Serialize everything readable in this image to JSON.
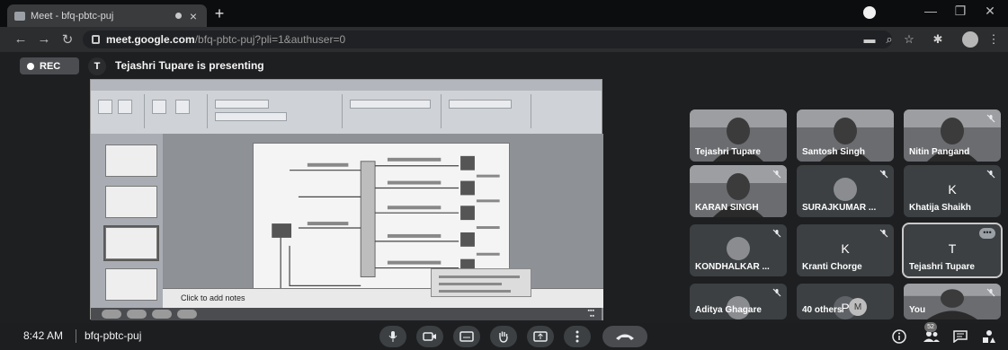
{
  "browser": {
    "tab_title": "Meet - bfq-pbtc-puj",
    "tab_close": "×",
    "new_tab": "+",
    "url_host": "meet.google.com",
    "url_path": "/bfq-pbtc-puj?pli=1&authuser=0",
    "window_controls": [
      "—",
      "❐",
      "✕"
    ]
  },
  "meet": {
    "rec_label": "REC",
    "presenter_initial": "T",
    "presenting_text": "Tejashri Tupare is presenting",
    "shared_screen": {
      "notes_placeholder": "Click to add notes"
    },
    "participants": [
      {
        "name": "Tejashri Tupare",
        "type": "video",
        "muted": false
      },
      {
        "name": "Santosh Singh",
        "type": "video",
        "muted": false
      },
      {
        "name": "Nitin Pangand",
        "type": "video",
        "muted": true
      },
      {
        "name": "KARAN SINGH",
        "type": "video",
        "muted": true
      },
      {
        "name": "SURAJKUMAR ...",
        "type": "avatar",
        "muted": true
      },
      {
        "name": "Khatija Shaikh",
        "type": "letter",
        "initial": "K",
        "muted": true
      },
      {
        "name": "KONDHALKAR ...",
        "type": "avatar",
        "muted": true
      },
      {
        "name": "Kranti Chorge",
        "type": "letter",
        "initial": "K",
        "muted": true
      },
      {
        "name": "Tejashri Tupare",
        "type": "letter",
        "initial": "T",
        "muted": false,
        "speaking": true
      },
      {
        "name": "Aditya Ghagare",
        "type": "avatar",
        "muted": true
      },
      {
        "name": "40 others",
        "type": "others",
        "initial": "P",
        "muted": false
      },
      {
        "name": "You",
        "type": "video",
        "muted": true
      }
    ],
    "more_badge": "•••",
    "others_badge": "M",
    "bottom": {
      "time": "8:42 AM",
      "meeting_code": "bfq-pbtc-puj",
      "people_count": "52"
    }
  },
  "colors": {
    "background": "#1e1f21",
    "tile": "#3c4043",
    "end_call": "#4a4b4e"
  }
}
